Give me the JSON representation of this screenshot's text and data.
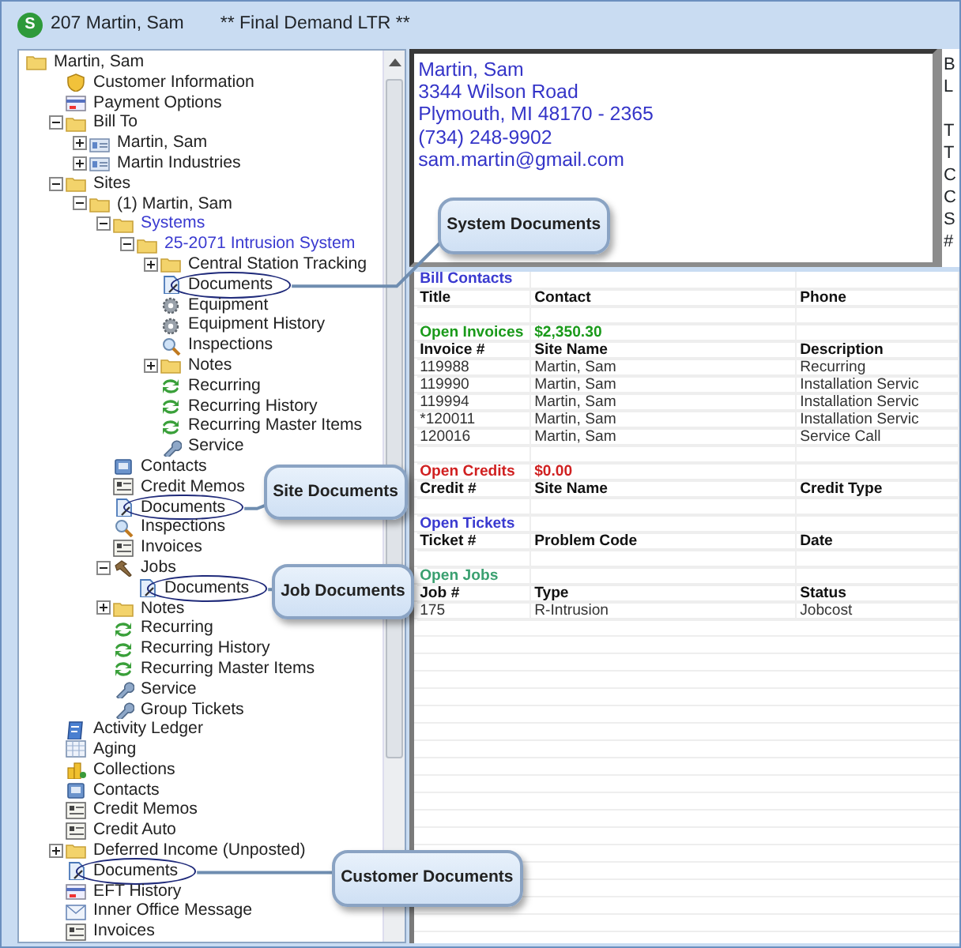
{
  "window": {
    "app_badge": "S",
    "title": "207  Martin, Sam",
    "subtitle": "** Final Demand LTR **"
  },
  "tree": {
    "label": "Martin, Sam",
    "kind": "folder",
    "children": [
      {
        "label": "Customer Information",
        "kind": "shield"
      },
      {
        "label": "Payment Options",
        "kind": "card"
      },
      {
        "label": "Bill To",
        "kind": "folder",
        "expanded": true,
        "children": [
          {
            "label": "Martin, Sam",
            "kind": "contact",
            "expanded": false
          },
          {
            "label": "Martin Industries",
            "kind": "contact",
            "expanded": false
          }
        ]
      },
      {
        "label": "Sites",
        "kind": "folder",
        "expanded": true,
        "children": [
          {
            "label": "(1) Martin, Sam",
            "kind": "folder",
            "expanded": true,
            "children": [
              {
                "label": "Systems",
                "kind": "folder",
                "expanded": true,
                "color": "#3a3ad0",
                "children": [
                  {
                    "label": "25-2071  Intrusion System",
                    "kind": "folder",
                    "expanded": true,
                    "color": "#3a3ad0",
                    "children": [
                      {
                        "label": "Central Station Tracking",
                        "kind": "folder",
                        "expanded": false
                      },
                      {
                        "label": "Documents",
                        "kind": "document",
                        "callout": "System Documents"
                      },
                      {
                        "label": "Equipment",
                        "kind": "gear"
                      },
                      {
                        "label": "Equipment History",
                        "kind": "gear"
                      },
                      {
                        "label": "Inspections",
                        "kind": "magnifier"
                      },
                      {
                        "label": "Notes",
                        "kind": "folder",
                        "expanded": false
                      },
                      {
                        "label": "Recurring",
                        "kind": "recurring"
                      },
                      {
                        "label": "Recurring History",
                        "kind": "recurring"
                      },
                      {
                        "label": "Recurring Master Items",
                        "kind": "recurring"
                      },
                      {
                        "label": "Service",
                        "kind": "wrench"
                      }
                    ]
                  }
                ]
              },
              {
                "label": "Contacts",
                "kind": "contacts"
              },
              {
                "label": "Credit Memos",
                "kind": "memo"
              },
              {
                "label": "Documents",
                "kind": "document",
                "callout": "Site Documents"
              },
              {
                "label": "Inspections",
                "kind": "magnifier"
              },
              {
                "label": "Invoices",
                "kind": "memo"
              },
              {
                "label": "Jobs",
                "kind": "hammer",
                "expanded": true,
                "children": [
                  {
                    "label": "Documents",
                    "kind": "document",
                    "callout": "Job Documents"
                  }
                ]
              },
              {
                "label": "Notes",
                "kind": "folder",
                "expanded": false
              },
              {
                "label": "Recurring",
                "kind": "recurring"
              },
              {
                "label": "Recurring History",
                "kind": "recurring"
              },
              {
                "label": "Recurring Master Items",
                "kind": "recurring"
              },
              {
                "label": "Service",
                "kind": "wrench"
              },
              {
                "label": "Group Tickets",
                "kind": "wrench"
              }
            ]
          }
        ]
      },
      {
        "label": "Activity Ledger",
        "kind": "ledger"
      },
      {
        "label": "Aging",
        "kind": "grid"
      },
      {
        "label": "Collections",
        "kind": "coins"
      },
      {
        "label": "Contacts",
        "kind": "contacts"
      },
      {
        "label": "Credit Memos",
        "kind": "memo"
      },
      {
        "label": "Credit Auto",
        "kind": "memo"
      },
      {
        "label": "Deferred Income (Unposted)",
        "kind": "folder",
        "expanded": false
      },
      {
        "label": "Documents",
        "kind": "document",
        "callout": "Customer Documents"
      },
      {
        "label": "EFT History",
        "kind": "card"
      },
      {
        "label": "Inner Office Message",
        "kind": "envelope"
      },
      {
        "label": "Invoices",
        "kind": "memo"
      }
    ]
  },
  "address": [
    "Martin, Sam",
    "3344 Wilson Road",
    "Plymouth, MI  48170 - 2365",
    "(734) 248-9902",
    "sam.martin@gmail.com"
  ],
  "side_panel": [
    [
      "B",
      "L"
    ],
    [
      "T",
      "T",
      "C",
      "C",
      "S",
      "#"
    ]
  ],
  "grid": {
    "rows": [
      {
        "kind": "section",
        "cells": [
          "Bill Contacts"
        ],
        "color": "#3a3ad0"
      },
      {
        "kind": "header",
        "cells": [
          "Title",
          "Contact",
          "Phone"
        ]
      },
      {
        "kind": "blank"
      },
      {
        "kind": "section",
        "cells": [
          "Open Invoices",
          "$2,350.30"
        ],
        "color": "#1a9a1a"
      },
      {
        "kind": "header",
        "cells": [
          "Invoice #",
          "Site Name",
          "Description"
        ]
      },
      {
        "kind": "data",
        "cells": [
          "119988",
          "Martin, Sam",
          "Recurring"
        ]
      },
      {
        "kind": "data",
        "cells": [
          "119990",
          "Martin, Sam",
          "Installation Servic"
        ]
      },
      {
        "kind": "data",
        "cells": [
          "119994",
          "Martin, Sam",
          "Installation Servic"
        ]
      },
      {
        "kind": "data",
        "cells": [
          "*120011",
          "Martin, Sam",
          "Installation Servic"
        ]
      },
      {
        "kind": "data",
        "cells": [
          "120016",
          "Martin, Sam",
          "Service Call"
        ]
      },
      {
        "kind": "blank"
      },
      {
        "kind": "section",
        "cells": [
          "Open Credits",
          "$0.00"
        ],
        "color": "#d02020"
      },
      {
        "kind": "header",
        "cells": [
          "Credit #",
          "Site Name",
          "Credit Type"
        ]
      },
      {
        "kind": "blank"
      },
      {
        "kind": "section",
        "cells": [
          "Open Tickets"
        ],
        "color": "#3a3ad0"
      },
      {
        "kind": "header",
        "cells": [
          "Ticket #",
          "Problem Code",
          "Date"
        ]
      },
      {
        "kind": "blank"
      },
      {
        "kind": "section",
        "cells": [
          "Open Jobs"
        ],
        "color": "#3aa070"
      },
      {
        "kind": "header",
        "cells": [
          "Job #",
          "Type",
          "Status"
        ]
      },
      {
        "kind": "data",
        "cells": [
          "175",
          "R-Intrusion",
          "Jobcost"
        ]
      }
    ]
  }
}
